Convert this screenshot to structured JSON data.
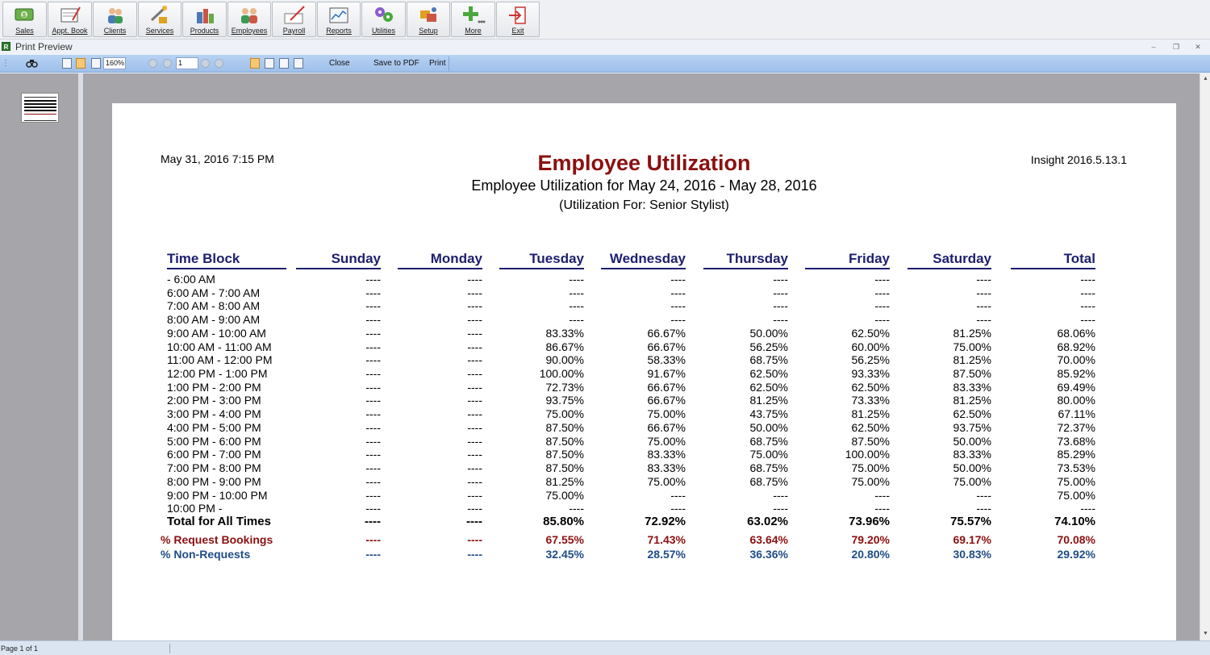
{
  "toolbar": {
    "buttons": [
      {
        "label": "Sales",
        "icon": "sales-icon"
      },
      {
        "label": "Appt. Book",
        "icon": "appt-book-icon"
      },
      {
        "label": "Clients",
        "icon": "clients-icon"
      },
      {
        "label": "Services",
        "icon": "services-icon"
      },
      {
        "label": "Products",
        "icon": "products-icon"
      },
      {
        "label": "Employees",
        "icon": "employees-icon"
      },
      {
        "label": "Payroll",
        "icon": "payroll-icon"
      },
      {
        "label": "Reports",
        "icon": "reports-icon"
      },
      {
        "label": "Utilities",
        "icon": "utilities-icon"
      },
      {
        "label": "Setup",
        "icon": "setup-icon"
      },
      {
        "label": "More",
        "icon": "more-icon"
      },
      {
        "label": "Exit",
        "icon": "exit-icon"
      }
    ]
  },
  "window": {
    "title": "Print Preview",
    "app_icon_letter": "R"
  },
  "preview_toolbar": {
    "zoom": "160%",
    "page_number": "1",
    "close_label": "Close",
    "save_pdf_label": "Save to PDF",
    "print_label": "Print"
  },
  "report": {
    "printed": "May 31, 2016 7:15 PM",
    "version": "Insight 2016.5.13.1",
    "title": "Employee Utilization",
    "subtitle": "Employee Utilization for May 24, 2016 - May 28, 2016",
    "filter": "(Utilization For: Senior Stylist)",
    "columns": [
      "Time Block",
      "Sunday",
      "Monday",
      "Tuesday",
      "Wednesday",
      "Thursday",
      "Friday",
      "Saturday",
      "Total"
    ],
    "rows": [
      [
        "- 6:00 AM",
        "----",
        "----",
        "----",
        "----",
        "----",
        "----",
        "----",
        "----"
      ],
      [
        "6:00 AM - 7:00 AM",
        "----",
        "----",
        "----",
        "----",
        "----",
        "----",
        "----",
        "----"
      ],
      [
        "7:00 AM - 8:00 AM",
        "----",
        "----",
        "----",
        "----",
        "----",
        "----",
        "----",
        "----"
      ],
      [
        "8:00 AM - 9:00 AM",
        "----",
        "----",
        "----",
        "----",
        "----",
        "----",
        "----",
        "----"
      ],
      [
        "9:00 AM - 10:00 AM",
        "----",
        "----",
        "83.33%",
        "66.67%",
        "50.00%",
        "62.50%",
        "81.25%",
        "68.06%"
      ],
      [
        "10:00 AM - 11:00 AM",
        "----",
        "----",
        "86.67%",
        "66.67%",
        "56.25%",
        "60.00%",
        "75.00%",
        "68.92%"
      ],
      [
        "11:00 AM - 12:00 PM",
        "----",
        "----",
        "90.00%",
        "58.33%",
        "68.75%",
        "56.25%",
        "81.25%",
        "70.00%"
      ],
      [
        "12:00 PM - 1:00 PM",
        "----",
        "----",
        "100.00%",
        "91.67%",
        "62.50%",
        "93.33%",
        "87.50%",
        "85.92%"
      ],
      [
        "1:00 PM - 2:00 PM",
        "----",
        "----",
        "72.73%",
        "66.67%",
        "62.50%",
        "62.50%",
        "83.33%",
        "69.49%"
      ],
      [
        "2:00 PM - 3:00 PM",
        "----",
        "----",
        "93.75%",
        "66.67%",
        "81.25%",
        "73.33%",
        "81.25%",
        "80.00%"
      ],
      [
        "3:00 PM - 4:00 PM",
        "----",
        "----",
        "75.00%",
        "75.00%",
        "43.75%",
        "81.25%",
        "62.50%",
        "67.11%"
      ],
      [
        "4:00 PM - 5:00 PM",
        "----",
        "----",
        "87.50%",
        "66.67%",
        "50.00%",
        "62.50%",
        "93.75%",
        "72.37%"
      ],
      [
        "5:00 PM - 6:00 PM",
        "----",
        "----",
        "87.50%",
        "75.00%",
        "68.75%",
        "87.50%",
        "50.00%",
        "73.68%"
      ],
      [
        "6:00 PM - 7:00 PM",
        "----",
        "----",
        "87.50%",
        "83.33%",
        "75.00%",
        "100.00%",
        "83.33%",
        "85.29%"
      ],
      [
        "7:00 PM - 8:00 PM",
        "----",
        "----",
        "87.50%",
        "83.33%",
        "68.75%",
        "75.00%",
        "50.00%",
        "73.53%"
      ],
      [
        "8:00 PM - 9:00 PM",
        "----",
        "----",
        "81.25%",
        "75.00%",
        "68.75%",
        "75.00%",
        "75.00%",
        "75.00%"
      ],
      [
        "9:00 PM - 10:00 PM",
        "----",
        "----",
        "75.00%",
        "----",
        "----",
        "----",
        "----",
        "75.00%"
      ],
      [
        "10:00 PM -",
        "----",
        "----",
        "----",
        "----",
        "----",
        "----",
        "----",
        "----"
      ]
    ],
    "total_row": [
      "Total for All Times",
      "----",
      "----",
      "85.80%",
      "72.92%",
      "63.02%",
      "73.96%",
      "75.57%",
      "74.10%"
    ],
    "request_row": [
      "% Request Bookings",
      "----",
      "----",
      "67.55%",
      "71.43%",
      "63.64%",
      "79.20%",
      "69.17%",
      "70.08%"
    ],
    "nonrequest_row": [
      "% Non-Requests",
      "----",
      "----",
      "32.45%",
      "28.57%",
      "36.36%",
      "20.80%",
      "30.83%",
      "29.92%"
    ]
  },
  "status": {
    "page_info": "Page 1 of 1"
  },
  "colors": {
    "title": "#8b1010",
    "header": "#1d1f6e",
    "request": "#8b1010",
    "nonrequest": "#1f4c86",
    "toolbar_blue": "#b7d2f3"
  }
}
